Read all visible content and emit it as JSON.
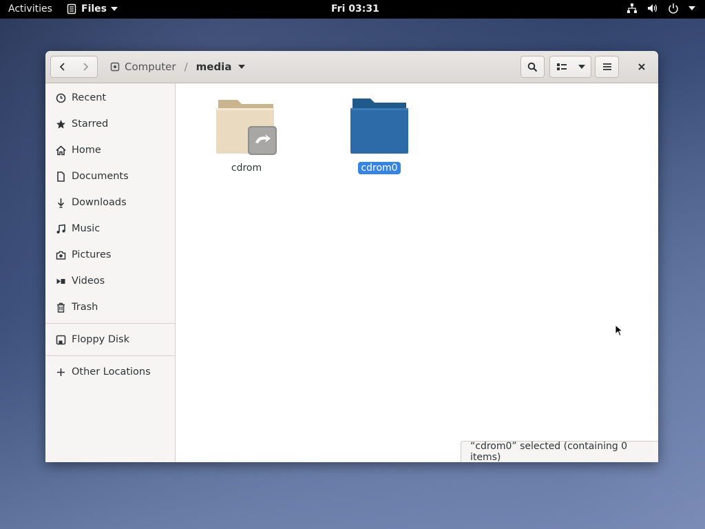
{
  "topbar": {
    "activities": "Activities",
    "app_name": "Files",
    "clock": "Fri 03:31"
  },
  "window": {
    "nav": {
      "back_icon": "go-previous-icon",
      "forward_icon": "go-next-icon"
    },
    "path": {
      "computer": "Computer",
      "separator": "/",
      "current": "media"
    },
    "toolbar": {
      "search_icon": "search-icon",
      "view_icon": "list-view-icon",
      "menu_icon": "hamburger-menu-icon",
      "close_icon": "close-icon"
    }
  },
  "sidebar": {
    "items": [
      {
        "label": "Recent",
        "icon": "clock-icon"
      },
      {
        "label": "Starred",
        "icon": "star-icon"
      },
      {
        "label": "Home",
        "icon": "home-icon"
      },
      {
        "label": "Documents",
        "icon": "document-icon"
      },
      {
        "label": "Downloads",
        "icon": "download-icon"
      },
      {
        "label": "Music",
        "icon": "music-icon"
      },
      {
        "label": "Pictures",
        "icon": "camera-icon"
      },
      {
        "label": "Videos",
        "icon": "video-icon"
      },
      {
        "label": "Trash",
        "icon": "trash-icon"
      }
    ],
    "devices": [
      {
        "label": "Floppy Disk",
        "icon": "floppy-icon"
      }
    ],
    "other": {
      "label": "Other Locations",
      "icon": "plus-icon"
    }
  },
  "files": [
    {
      "name": "cdrom",
      "type": "symlink-folder",
      "selected": false
    },
    {
      "name": "cdrom0",
      "type": "folder",
      "selected": true
    }
  ],
  "status": {
    "text": "“cdrom0” selected  (containing 0 items)"
  },
  "colors": {
    "accent": "#3584e4",
    "selected_folder": "#2a6aa8",
    "folder": "#e9d8b6"
  }
}
